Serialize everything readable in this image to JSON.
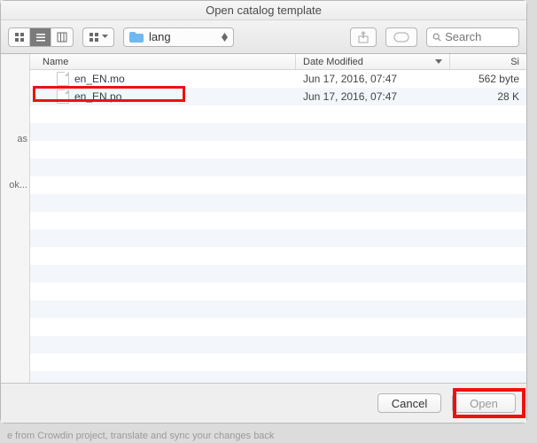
{
  "title": "Open catalog template",
  "toolbar": {
    "folder_name": "lang",
    "search_placeholder": "Search"
  },
  "sidebar": {
    "items": [
      "as",
      "ok..."
    ]
  },
  "columns": {
    "name": "Name",
    "date": "Date Modified",
    "size": "Si"
  },
  "files": [
    {
      "name": "en_EN.mo",
      "date": "Jun 17, 2016, 07:47",
      "size": "562 byte"
    },
    {
      "name": "en_EN.po",
      "date": "Jun 17, 2016, 07:47",
      "size": "28 K"
    }
  ],
  "buttons": {
    "cancel": "Cancel",
    "open": "Open"
  },
  "bg_hint": "e from Crowdin project, translate and sync your changes back"
}
